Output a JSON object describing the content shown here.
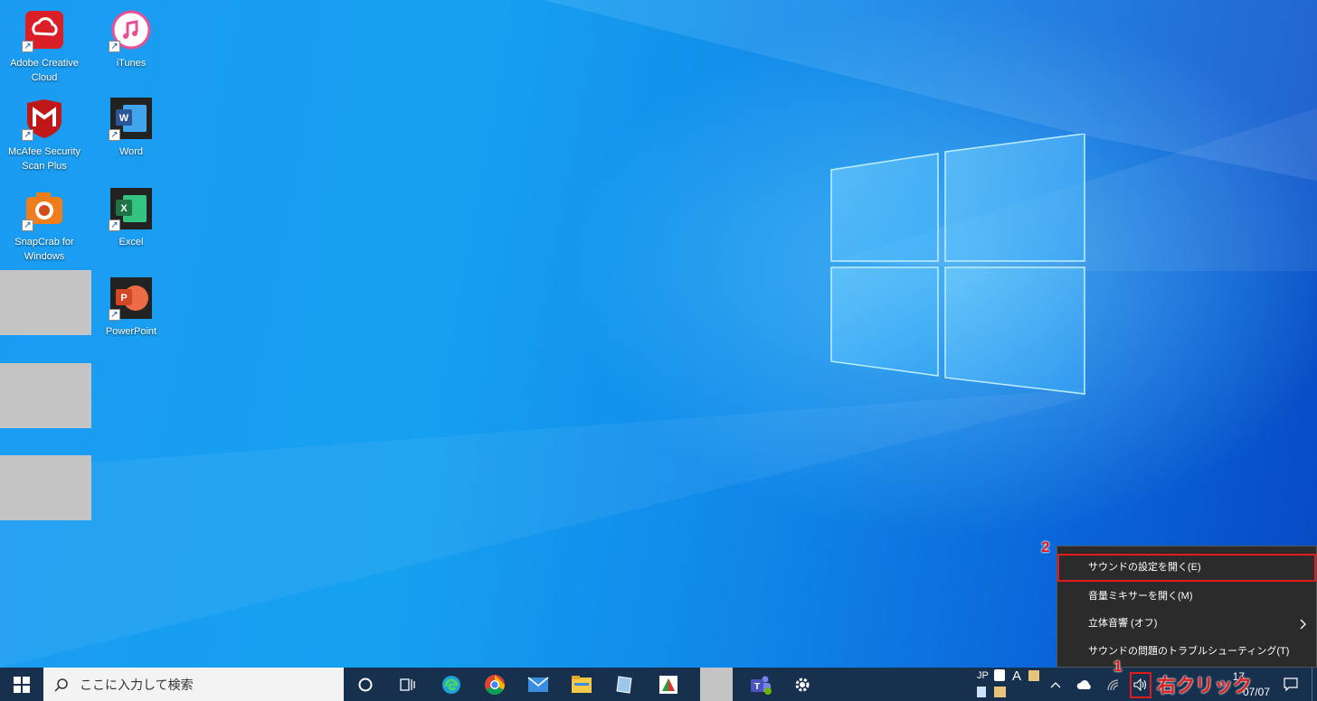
{
  "desktop": {
    "icons": [
      {
        "label": "Adobe Creative Cloud",
        "icon": "adobe-creative-cloud-icon",
        "color": "#da1f26"
      },
      {
        "label": "iTunes",
        "icon": "itunes-icon",
        "color": "#e94f93"
      },
      {
        "label": "McAfee Security Scan Plus",
        "icon": "mcafee-icon",
        "color": "#c01818"
      },
      {
        "label": "Word",
        "icon": "word-icon",
        "color": "#2b579a"
      },
      {
        "label": "SnapCrab for Windows",
        "icon": "snapcrab-icon",
        "color": "#f07d1b"
      },
      {
        "label": "Excel",
        "icon": "excel-icon",
        "color": "#217346"
      },
      {
        "label": "PowerPoint",
        "icon": "powerpoint-icon",
        "color": "#d24726"
      }
    ]
  },
  "taskbar": {
    "search_placeholder": "ここに入力して検索",
    "tray": {
      "ime_label": "JP",
      "ime_mode": "A",
      "time": "17",
      "date": "07/07"
    }
  },
  "context_menu": {
    "items": [
      {
        "label": "サウンドの設定を開く(E)"
      },
      {
        "label": "音量ミキサーを開く(M)"
      },
      {
        "label": "立体音響 (オフ)"
      },
      {
        "label": "サウンドの問題のトラブルシューティング(T)"
      }
    ]
  },
  "annotations": {
    "step1": "1",
    "step1_label": "右クリック",
    "step2": "2"
  },
  "colors": {
    "accent_red": "#e01b1b",
    "taskbar_bg": "#16304d",
    "menu_bg": "#2b2b2b"
  }
}
